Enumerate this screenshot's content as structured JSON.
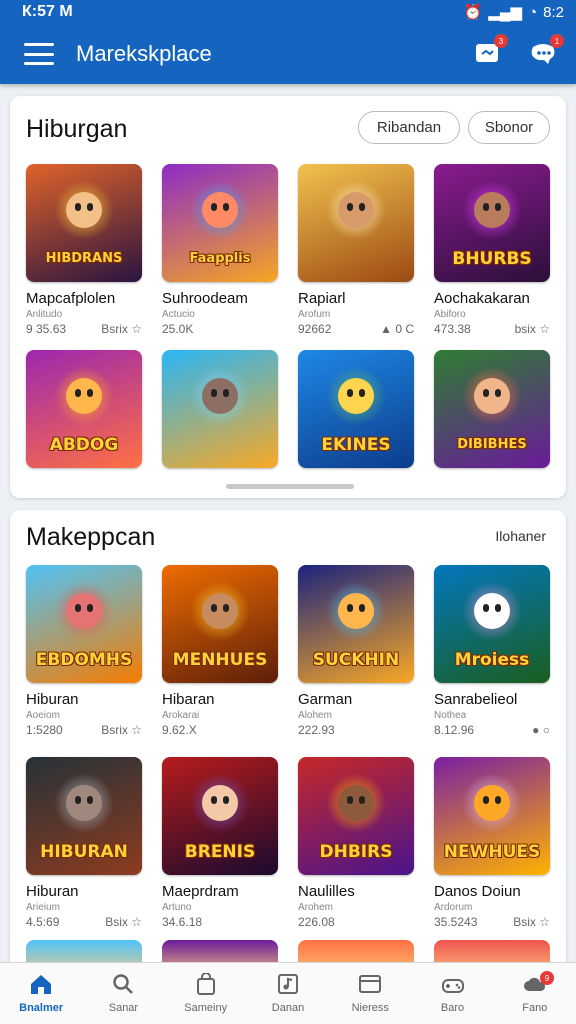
{
  "status_bar": {
    "time": "К:57 М",
    "clock": "8:2"
  },
  "app_bar": {
    "title": "Marekskplace",
    "badge_a": "3",
    "badge_b": "1"
  },
  "section1": {
    "title": "Hiburgan",
    "filter_pills": [
      "Ribandan",
      "Sbonor"
    ],
    "apps": [
      {
        "thumb_text": "HIBDRANS",
        "name": "Mapcafplolen",
        "dev": "Anlitudo",
        "meta_left": "9 35.63",
        "meta_right": "Bsrix ☆",
        "bg": [
          "#e0632a",
          "#2a1440"
        ],
        "glow": "#ffcc33",
        "face": "#f3c089"
      },
      {
        "thumb_text": "Faapplis",
        "name": "Suhroodeam",
        "dev": "Actucio",
        "meta_left": "25.0K",
        "meta_right": "",
        "bg": [
          "#8e2bc7",
          "#f5a623"
        ],
        "glow": "#42a5f5",
        "face": "#ff8a65"
      },
      {
        "thumb_text": "",
        "name": "Rapiarl",
        "dev": "Arofum",
        "meta_left": "92662",
        "meta_right": "▲ 0 C",
        "bg": [
          "#f2c14e",
          "#9c4a13"
        ],
        "glow": "#fff3c2",
        "face": "#d79b6b"
      },
      {
        "thumb_text": "BHURBS",
        "name": "Aochakakaran",
        "dev": "Abiforo",
        "meta_left": "473.38",
        "meta_right": "bsix ☆",
        "bg": [
          "#8a1b8f",
          "#2b0f3a"
        ],
        "glow": "#e040fb",
        "face": "#b97c5c"
      },
      {
        "thumb_text": "ABDOG",
        "name": "",
        "dev": "",
        "meta_left": "",
        "meta_right": "",
        "bg": [
          "#9c27b0",
          "#ff7043"
        ],
        "glow": "#ffa726",
        "face": "#ffb74d"
      },
      {
        "thumb_text": "",
        "name": "",
        "dev": "",
        "meta_left": "",
        "meta_right": "",
        "bg": [
          "#29b6f6",
          "#f9a825"
        ],
        "glow": "#81d4fa",
        "face": "#8d6e63"
      },
      {
        "thumb_text": "EKINES",
        "name": "",
        "dev": "",
        "meta_left": "",
        "meta_right": "",
        "bg": [
          "#1e88e5",
          "#0d3c8c"
        ],
        "glow": "#66bb6a",
        "face": "#ffd54f"
      },
      {
        "thumb_text": "DIBIBHES",
        "name": "",
        "dev": "",
        "meta_left": "",
        "meta_right": "",
        "bg": [
          "#2e7d32",
          "#6a1b9a"
        ],
        "glow": "#ff7043",
        "face": "#f0b58a"
      }
    ]
  },
  "section2": {
    "title": "Makeppcan",
    "see_more": "Ilohaner",
    "apps": [
      {
        "thumb_text": "EBDOMHS",
        "name": "Hiburan",
        "dev": "Aoeiom",
        "meta_left": "1:5280",
        "meta_right": "Bsrix ☆",
        "bg": [
          "#4fc3f7",
          "#f57c00"
        ],
        "glow": "#ef5350",
        "face": "#e57373"
      },
      {
        "thumb_text": "MENHUES",
        "name": "Hibaran",
        "dev": "Arokarai",
        "meta_left": "9.62.X",
        "meta_right": "",
        "bg": [
          "#ef6c00",
          "#5d1f0a"
        ],
        "glow": "#ffca28",
        "face": "#c68b5e"
      },
      {
        "thumb_text": "SUCKHIN",
        "name": "Garman",
        "dev": "Alohem",
        "meta_left": "222.93",
        "meta_right": "",
        "bg": [
          "#1a237e",
          "#f9a825"
        ],
        "glow": "#4fc3f7",
        "face": "#ffb74d"
      },
      {
        "thumb_text": "Mroiess",
        "name": "Sanrabelieol",
        "dev": "Nothea",
        "meta_left": "8.12.96",
        "meta_right": "● ○",
        "bg": [
          "#0277bd",
          "#1b5e20"
        ],
        "glow": "#ce93d8",
        "face": "#ffffff"
      },
      {
        "thumb_text": "HIBURAN",
        "name": "Hiburan",
        "dev": "Arieium",
        "meta_left": "4.5:69",
        "meta_right": "Bsix ☆",
        "bg": [
          "#263238",
          "#8d3b1f"
        ],
        "glow": "#b0bec5",
        "face": "#a1887f"
      },
      {
        "thumb_text": "BRENIS",
        "name": "Maeprdram",
        "dev": "Artuno",
        "meta_left": "34.6.18",
        "meta_right": "",
        "bg": [
          "#b71c1c",
          "#1a0a2e"
        ],
        "glow": "#7e57c2",
        "face": "#f3c9a8"
      },
      {
        "thumb_text": "DHBIRS",
        "name": "Naulilles",
        "dev": "Arohem",
        "meta_left": "226.08",
        "meta_right": "",
        "bg": [
          "#c62828",
          "#4a148c"
        ],
        "glow": "#ffb300",
        "face": "#8d5a3b"
      },
      {
        "thumb_text": "NEWHUES",
        "name": "Danos Doiun",
        "dev": "Ardorum",
        "meta_left": "35.5243",
        "meta_right": "Bsix ☆",
        "bg": [
          "#7b1fa2",
          "#ffb300"
        ],
        "glow": "#e1bee7",
        "face": "#ffa726"
      }
    ],
    "peek_colors": [
      "#4fc3f7",
      "#6a1b9a",
      "#ff7043",
      "#ef5350"
    ]
  },
  "bottom_nav": [
    {
      "label": "Bnalmer",
      "icon": "home-icon",
      "active": true
    },
    {
      "label": "Sanar",
      "icon": "search-icon",
      "active": false
    },
    {
      "label": "Sameiny",
      "icon": "bag-icon",
      "active": false
    },
    {
      "label": "Danan",
      "icon": "music-icon",
      "active": false
    },
    {
      "label": "Nieress",
      "icon": "card-icon",
      "active": false
    },
    {
      "label": "Baro",
      "icon": "gamepad-icon",
      "active": false
    },
    {
      "label": "Fano",
      "icon": "cloud-icon",
      "active": false,
      "badge": "9"
    }
  ],
  "colors": {
    "brand": "#1565c0",
    "badge": "#e53935",
    "active_nav": "#1565c0"
  }
}
